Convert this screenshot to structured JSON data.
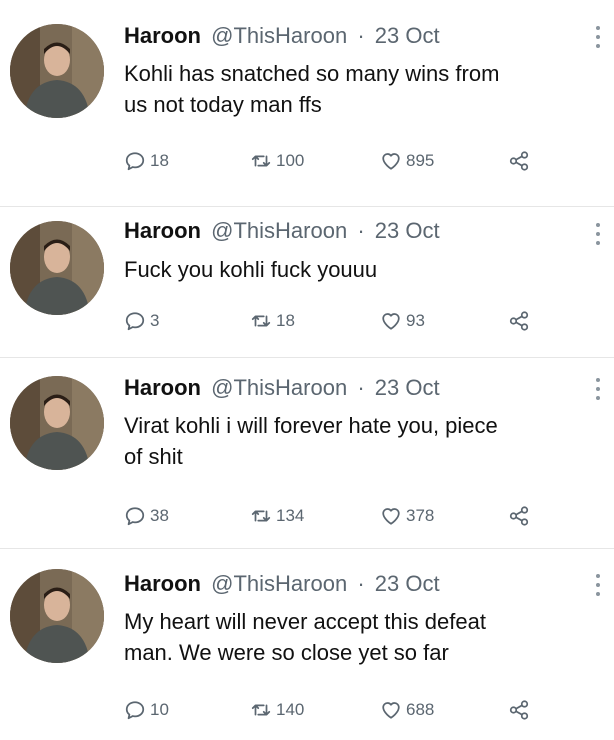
{
  "tweets": [
    {
      "name": "Haroon",
      "handle": "@ThisHaroon",
      "separator": "·",
      "date": "23 Oct",
      "text": "Kohli has snatched so many wins from\nus not today man ffs",
      "replies": "18",
      "retweets": "100",
      "likes": "895"
    },
    {
      "name": "Haroon",
      "handle": "@ThisHaroon",
      "separator": "·",
      "date": "23 Oct",
      "text": "Fuck you kohli fuck youuu",
      "replies": "3",
      "retweets": "18",
      "likes": "93"
    },
    {
      "name": "Haroon",
      "handle": "@ThisHaroon",
      "separator": "·",
      "date": "23 Oct",
      "text": "Virat kohli i will forever hate you, piece\nof shit",
      "replies": "38",
      "retweets": "134",
      "likes": "378"
    },
    {
      "name": "Haroon",
      "handle": "@ThisHaroon",
      "separator": "·",
      "date": "23 Oct",
      "text": "My heart will never accept this defeat\nman. We were so close yet so far",
      "replies": "10",
      "retweets": "140",
      "likes": "688"
    }
  ],
  "icons": {
    "reply": "reply-icon",
    "retweet": "retweet-icon",
    "like": "like-icon",
    "share": "share-icon",
    "more": "more-options-icon"
  },
  "colors": {
    "text": "#111111",
    "muted": "#5b6670",
    "divider": "#e6e6e6"
  }
}
